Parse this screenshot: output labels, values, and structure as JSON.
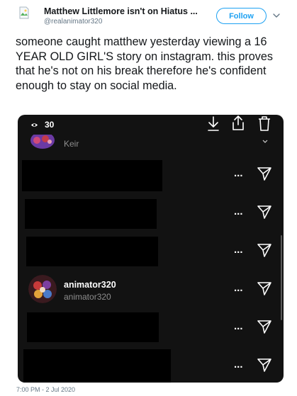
{
  "tweet": {
    "author_name": "Matthew Littlemore isn't on Hiatus ...",
    "author_handle": "@realanimator320",
    "follow_label": "Follow",
    "text": "someone caught matthew yesterday viewing a 16 YEAR OLD GIRL'S story on instagram. this proves that he's not on his break therefore he's confident enough to stay on social media.",
    "timestamp": "7:00 PM - 2 Jul 2020",
    "colors": {
      "accent": "#1da1f2",
      "text": "#14171a",
      "muted": "#657786"
    }
  },
  "screenshot": {
    "view_count": "30",
    "first_viewer_name": "Keir",
    "visible_user": {
      "name": "animator320",
      "subtitle": "animator320"
    },
    "row_more_label": "...",
    "colors": {
      "background": "#121212",
      "redaction": "#000000"
    },
    "icons": [
      "eye-icon",
      "download-icon",
      "share-icon",
      "trash-icon",
      "chevron-down-icon",
      "more-icon",
      "send-icon"
    ]
  }
}
